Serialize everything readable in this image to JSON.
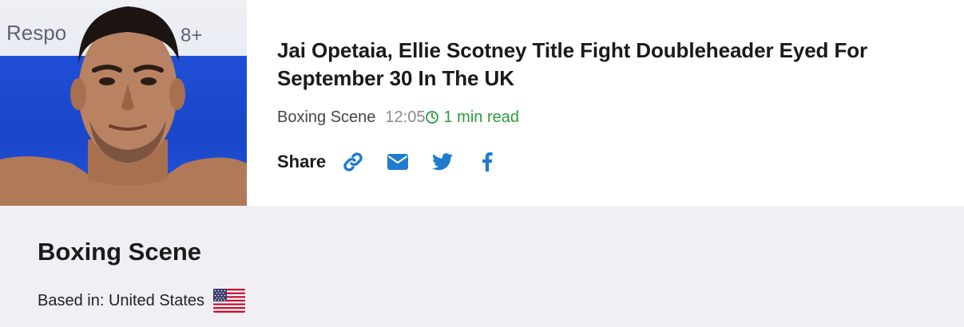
{
  "article": {
    "headline": "Jai Opetaia, Ellie Scotney Title Fight Doubleheader Eyed For September 30 In The UK",
    "source": "Boxing Scene",
    "time": "12:05",
    "read_time": "1 min read",
    "share_label": "Share",
    "share_buttons": [
      "link-icon",
      "email-icon",
      "twitter-icon",
      "facebook-icon"
    ],
    "thumbnail_backdrop_text": "Respo",
    "thumbnail_backdrop_text_right": "8+"
  },
  "source_panel": {
    "name": "Boxing Scene",
    "based_in": "Based in: United States",
    "flag": "us-flag-icon"
  },
  "colors": {
    "accent_blue": "#1f7bd0",
    "read_green": "#2e9a3e",
    "panel_bg": "#f1eff4"
  }
}
